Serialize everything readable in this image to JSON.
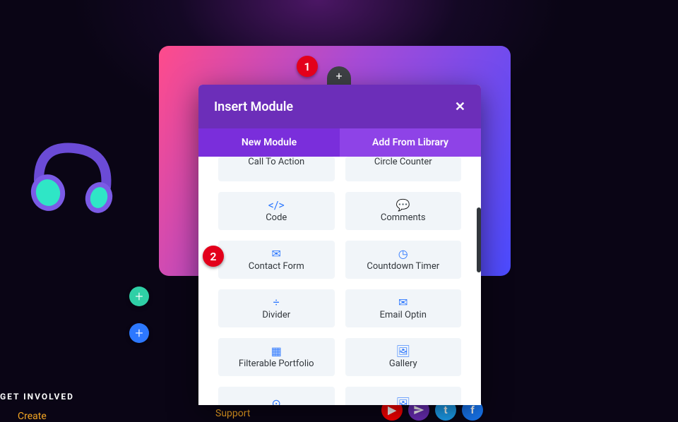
{
  "modal": {
    "title": "Insert Module",
    "tabs": {
      "new": "New Module",
      "library": "Add From Library"
    }
  },
  "modules": [
    {
      "label": "Call To Action",
      "icon": "="
    },
    {
      "label": "Circle Counter",
      "icon": "◔"
    },
    {
      "label": "Code",
      "icon": "</>"
    },
    {
      "label": "Comments",
      "icon": "💬"
    },
    {
      "label": "Contact Form",
      "icon": "✉"
    },
    {
      "label": "Countdown Timer",
      "icon": "◷"
    },
    {
      "label": "Divider",
      "icon": "÷"
    },
    {
      "label": "Email Optin",
      "icon": "✉"
    },
    {
      "label": "Filterable Portfolio",
      "icon": "▦"
    },
    {
      "label": "Gallery",
      "icon": "🖼"
    },
    {
      "label": "",
      "icon": "⊙"
    },
    {
      "label": "",
      "icon": "🖼"
    }
  ],
  "badges": {
    "one": "1",
    "two": "2"
  },
  "footer": {
    "get_involved": "GET INVOLVED",
    "create": "Create",
    "support": "Support"
  },
  "social": {
    "yt": "▶",
    "tw": "t",
    "fb": "f"
  }
}
